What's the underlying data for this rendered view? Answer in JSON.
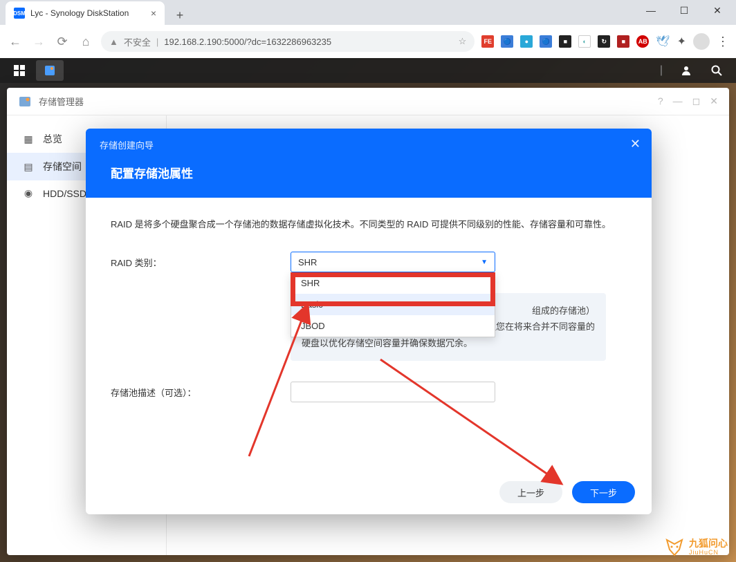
{
  "browser": {
    "tab_title": "Lyc - Synology DiskStation",
    "favicon_text": "DSM",
    "url_not_secure": "不安全",
    "url": "192.168.2.190:5000/?dc=1632286963235"
  },
  "storage_manager": {
    "title": "存储管理器",
    "sidebar": {
      "overview": "总览",
      "storage": "存储空间",
      "hdd_ssd": "HDD/SSD"
    }
  },
  "wizard": {
    "breadcrumb": "存储创建向导",
    "title": "配置存储池属性",
    "description": "RAID 是将多个硬盘聚合成一个存储池的数据存储虚拟化技术。不同类型的 RAID 可提供不同级别的性能、存储容量和可靠性。",
    "raid_label": "RAID 类别：",
    "raid_selected": "SHR",
    "raid_options": [
      "SHR",
      "Basic",
      "JBOD"
    ],
    "note_line1_tail": "组成的存储池）",
    "note_line2_tail": "让您在将来合并不同容量的",
    "note_line3": "硬盘以优化存储空间容量并确保数据冗余。",
    "desc_label": "存储池描述（可选）：",
    "btn_prev": "上一步",
    "btn_next": "下一步"
  },
  "watermark": {
    "cn": "九狐问心",
    "en": "JiuHuCN"
  }
}
